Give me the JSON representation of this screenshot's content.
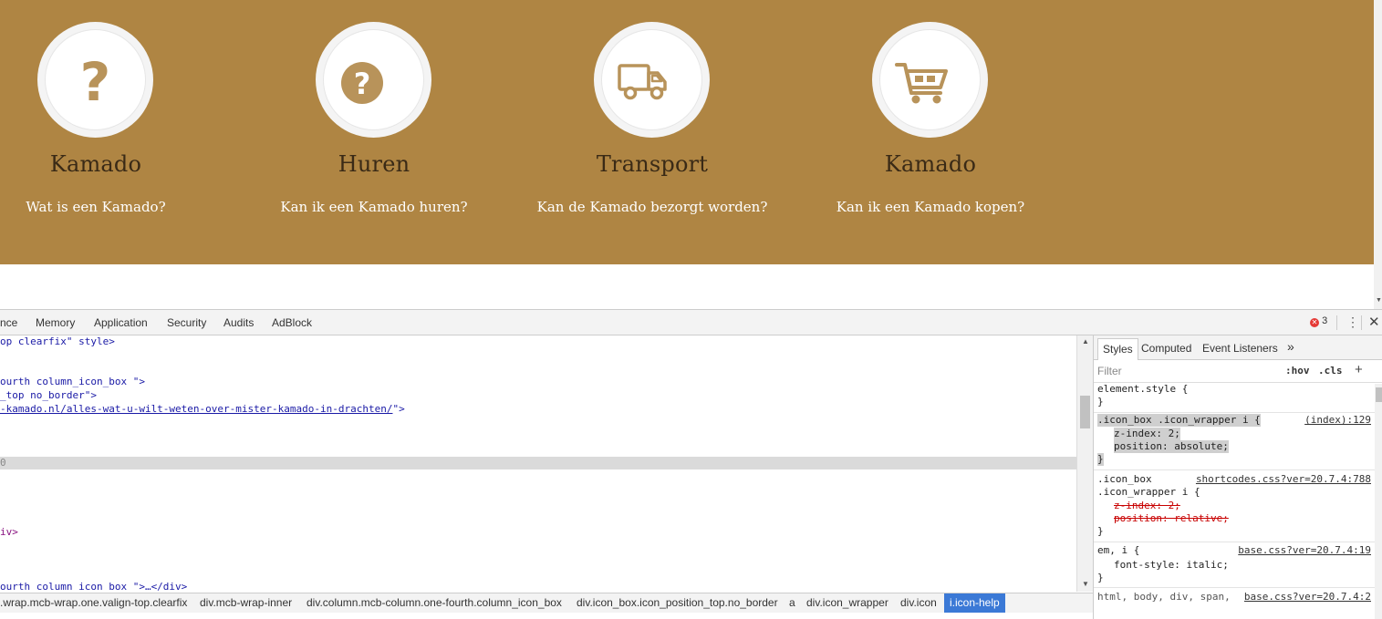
{
  "website": {
    "band_color": "#af8543",
    "features": [
      {
        "title": "Kamado",
        "subtitle": "Wat is een Kamado?",
        "icon": "question-mark-icon"
      },
      {
        "title": "Huren",
        "subtitle": "Kan ik een Kamado huren?",
        "icon": "question-circle-icon"
      },
      {
        "title": "Transport",
        "subtitle": "Kan de Kamado bezorgt worden?",
        "icon": "truck-icon"
      },
      {
        "title": "Kamado",
        "subtitle": "Kan ik een Kamado kopen?",
        "icon": "shopping-cart-icon"
      }
    ]
  },
  "devtools": {
    "tabs": [
      "nce",
      "Memory",
      "Application",
      "Security",
      "Audits",
      "AdBlock"
    ],
    "error_count": "3",
    "elements": {
      "line1": "op clearfix\" style>",
      "line2": "ourth column_icon_box \">",
      "line3": "_top no_border\">",
      "line4": "-kamado.nl/alles-wat-u-wilt-weten-over-mister-kamado-in-drachten/",
      "line4_end": "\">",
      "line5": "0",
      "line6": "iv>",
      "line7": "ourth column_icon_box \">…</div>"
    },
    "breadcrumbs": [
      ".wrap.mcb-wrap.one.valign-top.clearfix",
      "div.mcb-wrap-inner",
      "div.column.mcb-column.one-fourth.column_icon_box",
      "div.icon_box.icon_position_top.no_border",
      "a",
      "div.icon_wrapper",
      "div.icon",
      "i.icon-help"
    ],
    "styles": {
      "tabs": [
        "Styles",
        "Computed",
        "Event Listeners",
        "»"
      ],
      "filter_placeholder": "Filter",
      "hov": ":hov",
      "cls": ".cls",
      "plus": "+",
      "element_style": "element.style {",
      "close_brace": "}",
      "rule1": {
        "selector": ".icon_box .icon_wrapper i {",
        "source": "(index):129",
        "props": [
          "z-index: 2;",
          "position: absolute;"
        ]
      },
      "rule2": {
        "selector_a": ".icon_box",
        "selector_b": ".icon_wrapper i {",
        "source": "shortcodes.css?ver=20.7.4:788",
        "props": [
          "z-index: 2;",
          "position: relative;"
        ]
      },
      "rule3": {
        "selector": "em, i {",
        "source": "base.css?ver=20.7.4:19",
        "props": [
          "font-style: italic;"
        ]
      },
      "rule4": {
        "selector": "html, body, div, span,",
        "source": "base.css?ver=20.7.4:2"
      }
    }
  }
}
